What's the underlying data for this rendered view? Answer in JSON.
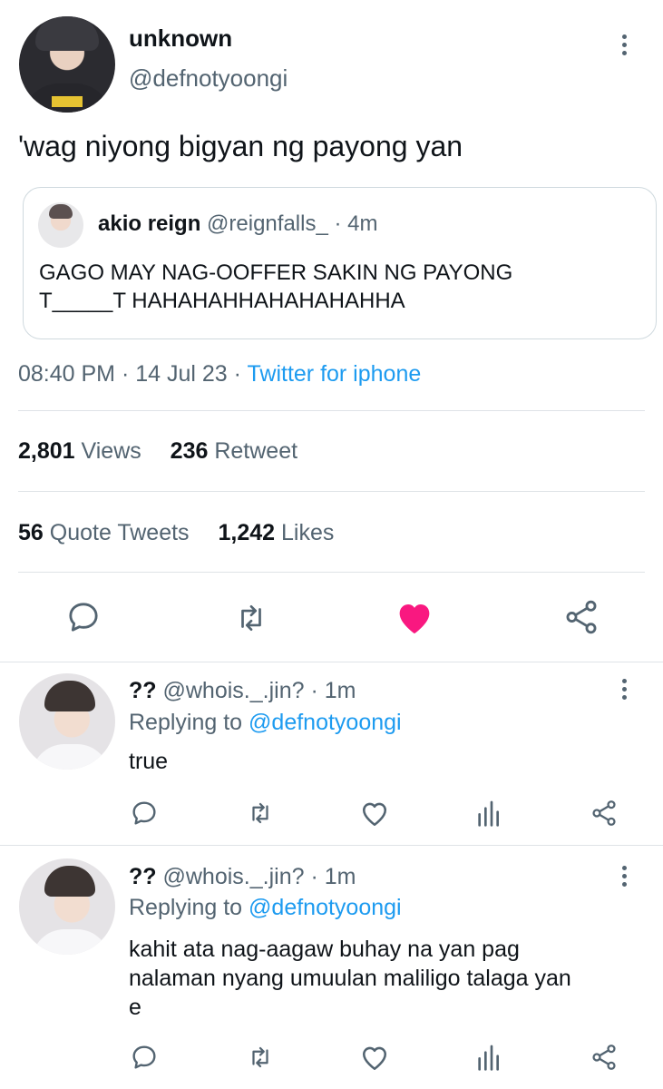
{
  "tweet": {
    "display_name": "unknown",
    "handle": "@defnotyoongi",
    "text": "'wag niyong bigyan ng payong yan",
    "quote": {
      "display_name": "akio reign",
      "handle": "@reignfalls_",
      "sep": "·",
      "time": "4m",
      "line1": "GAGO MAY NAG-OOFFER SAKIN NG PAYONG",
      "line2": "T_____T HAHAHAHHAHAHAHAHHA"
    },
    "time": "08:40 PM",
    "sep1": "·",
    "date": "14 Jul 23",
    "sep2": "·",
    "source": "Twitter for iphone",
    "stats": {
      "views_count": "2,801",
      "views_label": "Views",
      "retweet_count": "236",
      "retweet_label": "Retweet",
      "quote_count": "56",
      "quote_label": "Quote Tweets",
      "likes_count": "1,242",
      "likes_label": "Likes"
    },
    "liked": true
  },
  "replies": [
    {
      "display_name": "??",
      "handle": "@whois._.jin?",
      "sep": "·",
      "time": "1m",
      "replying_label": "Replying to",
      "replying_handle": "@defnotyoongi",
      "lines": [
        "true"
      ]
    },
    {
      "display_name": "??",
      "handle": "@whois._.jin?",
      "sep": "·",
      "time": "1m",
      "replying_label": "Replying to",
      "replying_handle": "@defnotyoongi",
      "lines": [
        "kahit ata nag-aagaw buhay na yan pag",
        "nalaman nyang umuulan maliligo talaga yan",
        "e"
      ]
    }
  ],
  "icons": [
    "reply-icon",
    "retweet-icon",
    "like-icon",
    "share-icon",
    "analytics-icon",
    "more-icon"
  ],
  "colors": {
    "accent": "#1d9bf0",
    "like": "#f91880",
    "text": "#0f1419",
    "secondary": "#536471",
    "divider": "#dfe3e7"
  }
}
